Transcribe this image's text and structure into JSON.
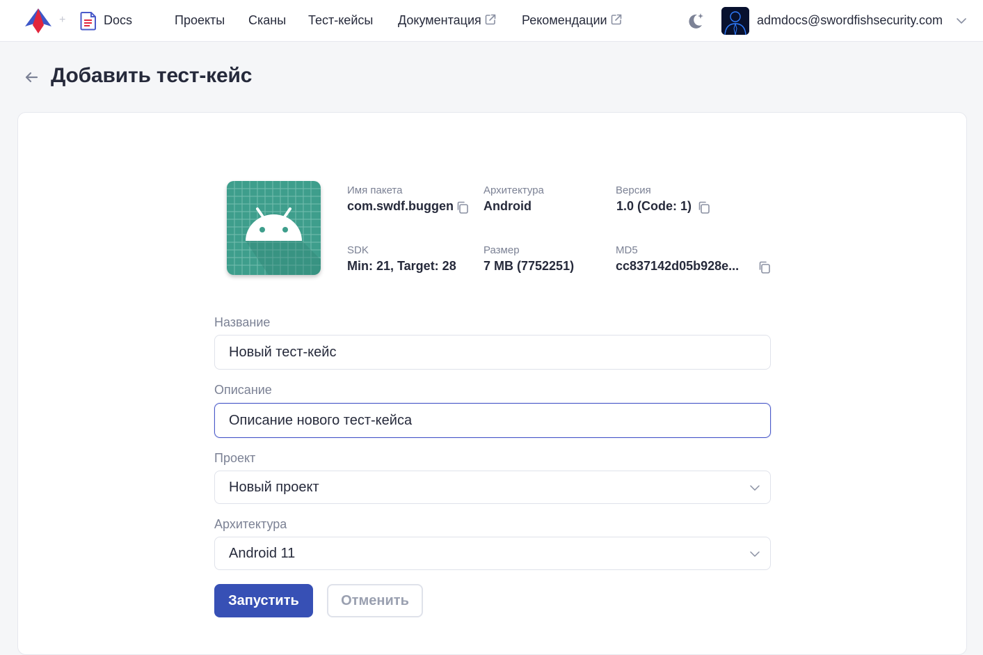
{
  "header": {
    "docs_label": "Docs",
    "plus_separator": "+",
    "nav": [
      {
        "label": "Проекты",
        "external": false
      },
      {
        "label": "Сканы",
        "external": false
      },
      {
        "label": "Тест-кейсы",
        "external": false
      },
      {
        "label": "Документация",
        "external": true
      },
      {
        "label": "Рекомендации",
        "external": true
      }
    ],
    "user_email": "admdocs@swordfishsecurity.com",
    "icons": [
      "logo-icon",
      "docs-icon",
      "external-link-icon",
      "theme-toggle-icon",
      "avatar",
      "chevron-down-icon"
    ]
  },
  "page": {
    "title": "Добавить тест-кейс",
    "back_icon": "arrow-left-icon"
  },
  "app_info": {
    "icon": "android-app-icon",
    "package_name": {
      "label": "Имя пакета",
      "value": "com.swdf.buggen"
    },
    "architecture": {
      "label": "Архитектура",
      "value": "Android"
    },
    "version": {
      "label": "Версия",
      "value": "1.0 (Code: 1)"
    },
    "sdk": {
      "label": "SDK",
      "value": "Min: 21, Target: 28"
    },
    "size": {
      "label": "Размер",
      "value": "7 MB (7752251)"
    },
    "md5": {
      "label": "MD5",
      "value": "cc837142d05b928e..."
    }
  },
  "form": {
    "name": {
      "label": "Название",
      "value": "Новый тест-кейс"
    },
    "description": {
      "label": "Описание",
      "value": "Описание нового тест-кейса"
    },
    "project": {
      "label": "Проект",
      "value": "Новый проект"
    },
    "architecture": {
      "label": "Архитектура",
      "value": "Android 11"
    },
    "submit_label": "Запустить",
    "cancel_label": "Отменить"
  },
  "colors": {
    "primary": "#3750b5",
    "focus_border": "#4a5ac9",
    "android_icon_bg": "#3e9e8c",
    "page_bg": "#f5f6f8"
  }
}
